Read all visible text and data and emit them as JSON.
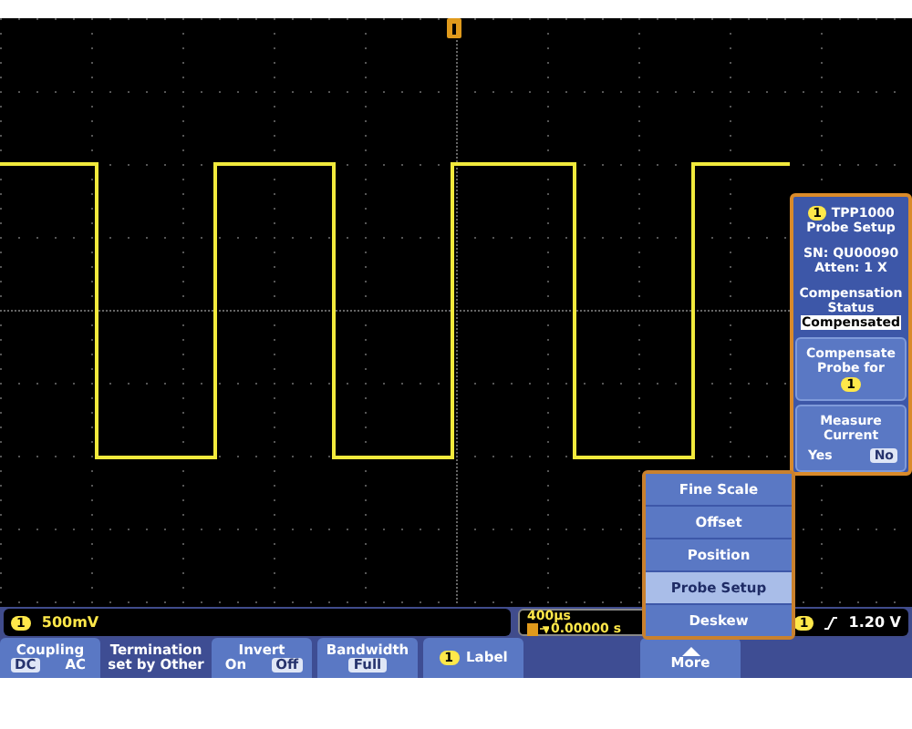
{
  "channel_readout": {
    "channel": "1",
    "scale": "500mV"
  },
  "time_readout": {
    "scale": "400µs",
    "position": "0.00000 s"
  },
  "trigger_readout": {
    "channel": "1",
    "level": "1.20 V"
  },
  "side_panel": {
    "channel": "1",
    "model": "TPP1000",
    "title": "Probe Setup",
    "serial": "SN: QU00090",
    "attenuation": "Atten: 1 X",
    "status_label": "Compensation Status",
    "status_value": "Compensated",
    "compensate_button": {
      "label": "Compensate Probe for",
      "channel": "1"
    },
    "measure_current": {
      "label": "Measure Current",
      "options": [
        {
          "label": "Yes",
          "selected": false
        },
        {
          "label": "No",
          "selected": true
        }
      ]
    }
  },
  "menu": [
    {
      "label": "Fine Scale",
      "selected": false
    },
    {
      "label": "Offset",
      "selected": false
    },
    {
      "label": "Position",
      "selected": false
    },
    {
      "label": "Probe Setup",
      "selected": true
    },
    {
      "label": "Deskew",
      "selected": false
    }
  ],
  "bottom_buttons": [
    {
      "kind": "toggle",
      "label": "Coupling",
      "options": [
        {
          "label": "DC",
          "selected": true
        },
        {
          "label": "AC",
          "selected": false
        }
      ]
    },
    {
      "kind": "text",
      "label": "Termination set by Other"
    },
    {
      "kind": "toggle",
      "label": "Invert",
      "options": [
        {
          "label": "On",
          "selected": false
        },
        {
          "label": "Off",
          "selected": true
        }
      ]
    },
    {
      "kind": "value",
      "label": "Bandwidth",
      "value": "Full"
    },
    {
      "kind": "channel",
      "channel": "1",
      "label": "Label"
    },
    {
      "kind": "blank"
    },
    {
      "kind": "more",
      "label": "More"
    }
  ]
}
